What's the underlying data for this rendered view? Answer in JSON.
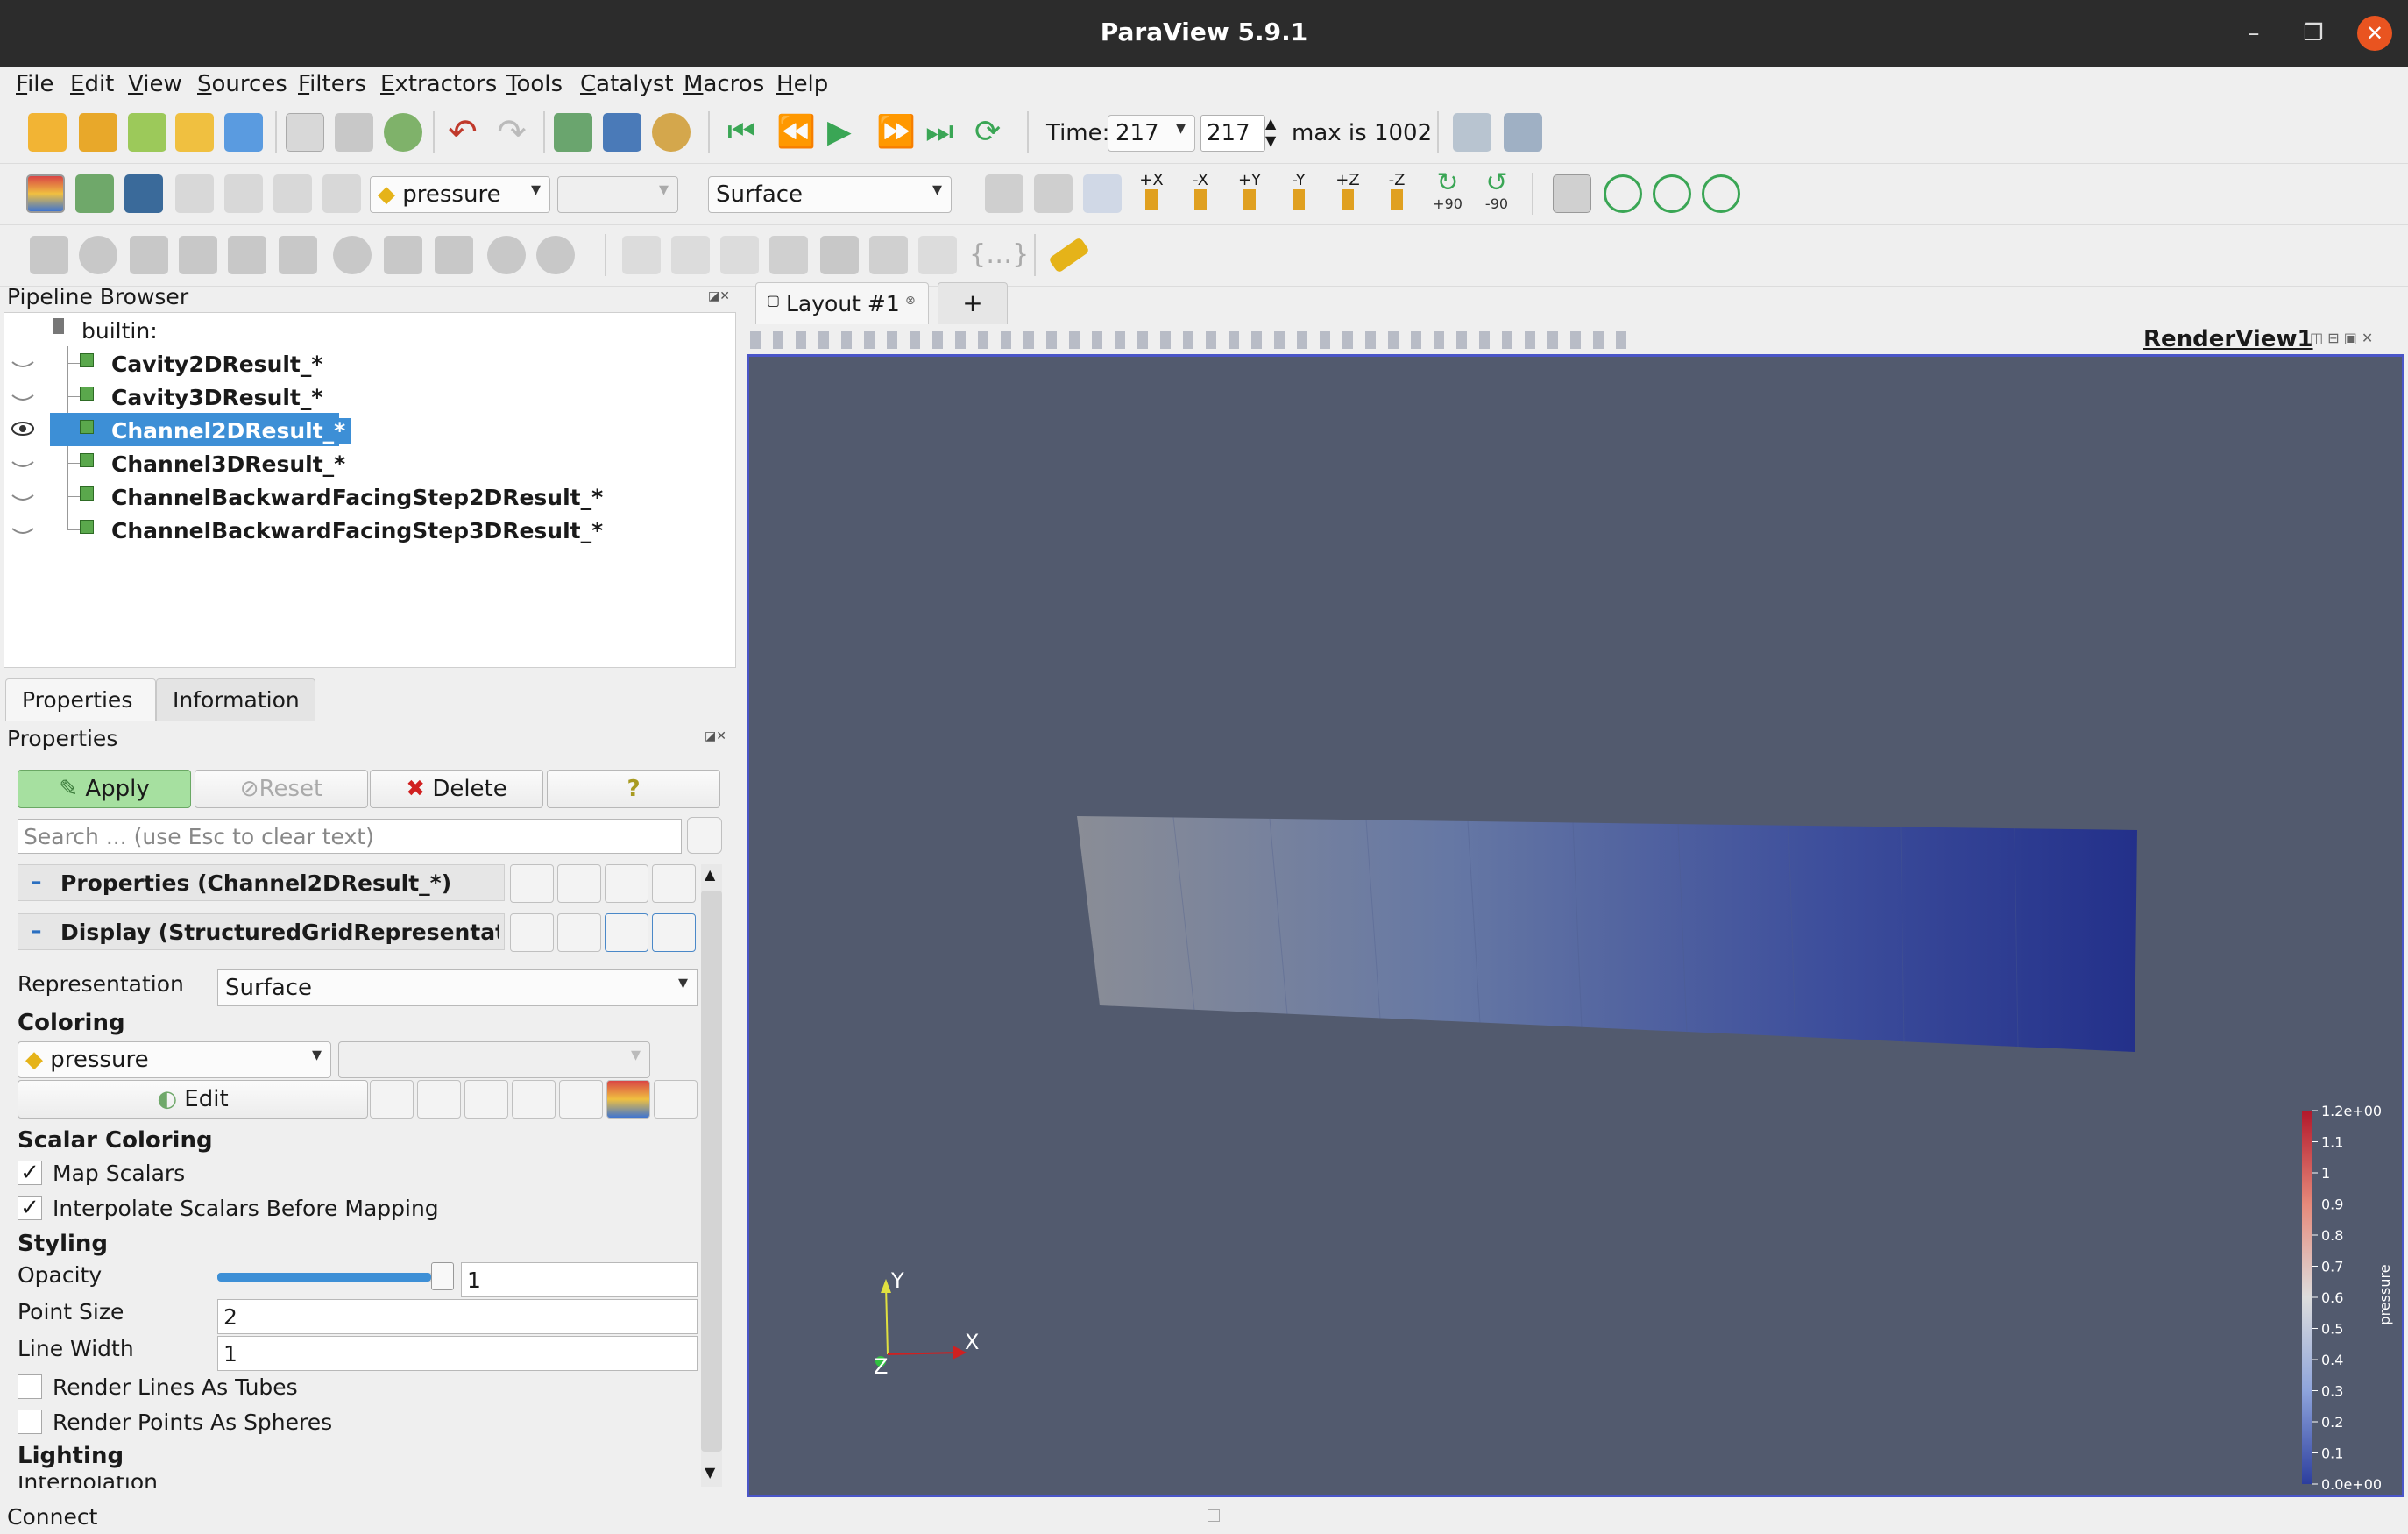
{
  "window": {
    "title": "ParaView 5.9.1",
    "minimize": "–",
    "restore": "❐",
    "close": "✕"
  },
  "menu": [
    "File",
    "Edit",
    "View",
    "Sources",
    "Filters",
    "Extractors",
    "Tools",
    "Catalyst",
    "Macros",
    "Help"
  ],
  "toolbar": {
    "time_label": "Time:",
    "time_value": "217",
    "time_index": "217",
    "max_label": "max is 1002",
    "array_name": "pressure",
    "component": "",
    "representation": "Surface",
    "camera_labels": [
      "+X",
      "-X",
      "+Y",
      "-Y",
      "+Z",
      "-Z"
    ],
    "rotate_pos": "+90",
    "rotate_neg": "-90"
  },
  "pipeline": {
    "title": "Pipeline Browser",
    "root": "builtin:",
    "items": [
      {
        "name": "Cavity2DResult_*",
        "visible": false
      },
      {
        "name": "Cavity3DResult_*",
        "visible": false
      },
      {
        "name": "Channel2DResult_*",
        "visible": true
      },
      {
        "name": "Channel3DResult_*",
        "visible": false
      },
      {
        "name": "ChannelBackwardFacingStep2DResult_*",
        "visible": false
      },
      {
        "name": "ChannelBackwardFacingStep3DResult_*",
        "visible": false
      }
    ]
  },
  "tabs": {
    "properties": "Properties",
    "information": "Information"
  },
  "properties": {
    "title": "Properties",
    "apply": "Apply",
    "reset": "Reset",
    "delete": "Delete",
    "help": "?",
    "search_placeholder": "Search ... (use Esc to clear text)",
    "section_props": "Properties (Channel2DResult_*)",
    "section_display": "Display (StructuredGridRepresentat",
    "representation_label": "Representation",
    "representation_value": "Surface",
    "coloring_label": "Coloring",
    "coloring_array": "pressure",
    "edit_label": "Edit",
    "scalar_coloring_label": "Scalar Coloring",
    "map_scalars": "Map Scalars",
    "interpolate": "Interpolate Scalars Before Mapping",
    "styling_label": "Styling",
    "opacity_label": "Opacity",
    "opacity_value": "1",
    "opacity_fraction": 1.0,
    "point_size_label": "Point Size",
    "point_size_value": "2",
    "line_width_label": "Line Width",
    "line_width_value": "1",
    "tubes_label": "Render Lines As Tubes",
    "spheres_label": "Render Points As Spheres",
    "lighting_label": "Lighting",
    "interpolation_partial": "Interpolation"
  },
  "layout": {
    "tab": "Layout #1",
    "add": "+",
    "view_name": "RenderView1"
  },
  "colorbar": {
    "title": "pressure",
    "labels": [
      "1.2e+00",
      "1.1",
      "1",
      "0.9",
      "0.8",
      "0.7",
      "0.6",
      "0.5",
      "0.4",
      "0.3",
      "0.2",
      "0.1",
      "0.0e+00"
    ],
    "color_high": "#b2182b",
    "color_low": "#2c3e9e"
  },
  "axes": {
    "x": "X",
    "y": "Y",
    "z": "Z"
  },
  "status": {
    "text": "Connect"
  },
  "colors": {
    "render_bg": "#525a6e",
    "selection": "#3d8fd6",
    "apply_green": "#a6e0a0",
    "frame_blue": "#4a55c8"
  }
}
